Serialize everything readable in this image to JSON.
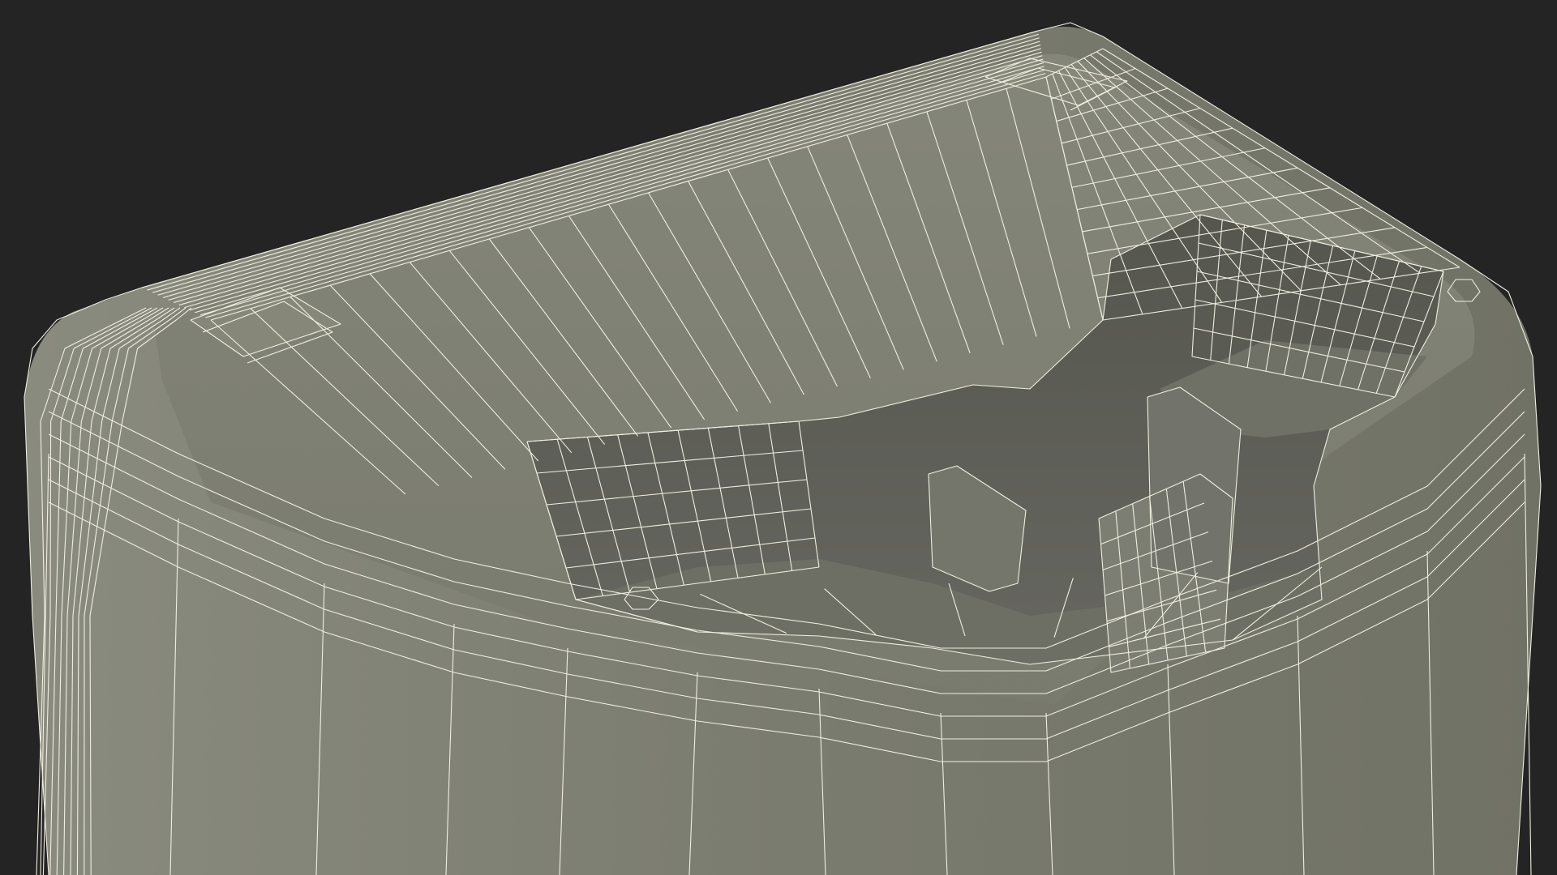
{
  "scene": {
    "background_color": "#242424",
    "surface_color": "#7b7c70",
    "inner_wall_color": "#5d5e55",
    "floor_color": "#6e6f64",
    "wire_color": "#efeee0",
    "subject": "wireframe-3d-container-top"
  }
}
